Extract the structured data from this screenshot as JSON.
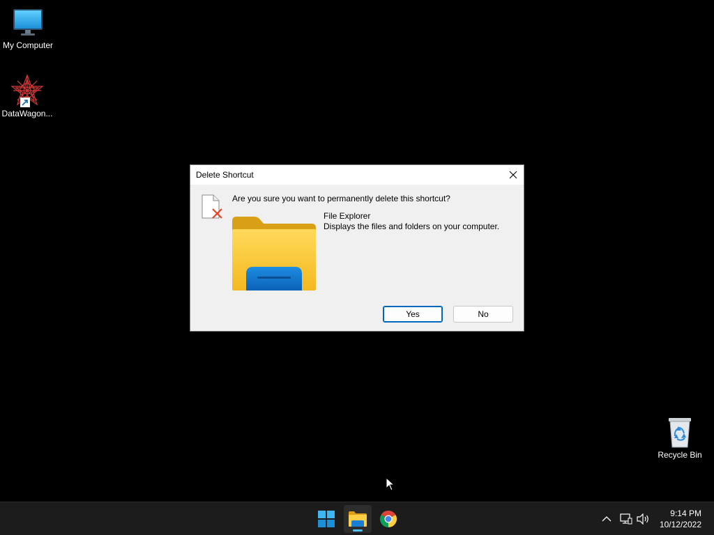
{
  "desktop": {
    "icons": [
      {
        "label": "My Computer",
        "icon": "monitor-icon"
      },
      {
        "label": "DataWagon...",
        "icon": "datawagon-app-icon"
      },
      {
        "label": "Recycle Bin",
        "icon": "recycle-bin-icon"
      }
    ]
  },
  "dialog": {
    "title": "Delete Shortcut",
    "question": "Are you sure you want to permanently delete this shortcut?",
    "item_name": "File Explorer",
    "item_description": "Displays the files and folders on your computer.",
    "yes_label": "Yes",
    "no_label": "No",
    "close_icon": "close-icon",
    "accent_color": "#0067c0"
  },
  "taskbar": {
    "apps": [
      {
        "icon": "windows-start-icon",
        "active": false
      },
      {
        "icon": "file-explorer-icon",
        "active": true
      },
      {
        "icon": "chrome-icon",
        "active": false
      }
    ],
    "tray": {
      "icons": [
        "chevron-up-icon",
        "network-icon",
        "volume-icon"
      ],
      "time": "9:14 PM",
      "date": "10/12/2022"
    },
    "indicator_color": "#4cc2ff"
  }
}
